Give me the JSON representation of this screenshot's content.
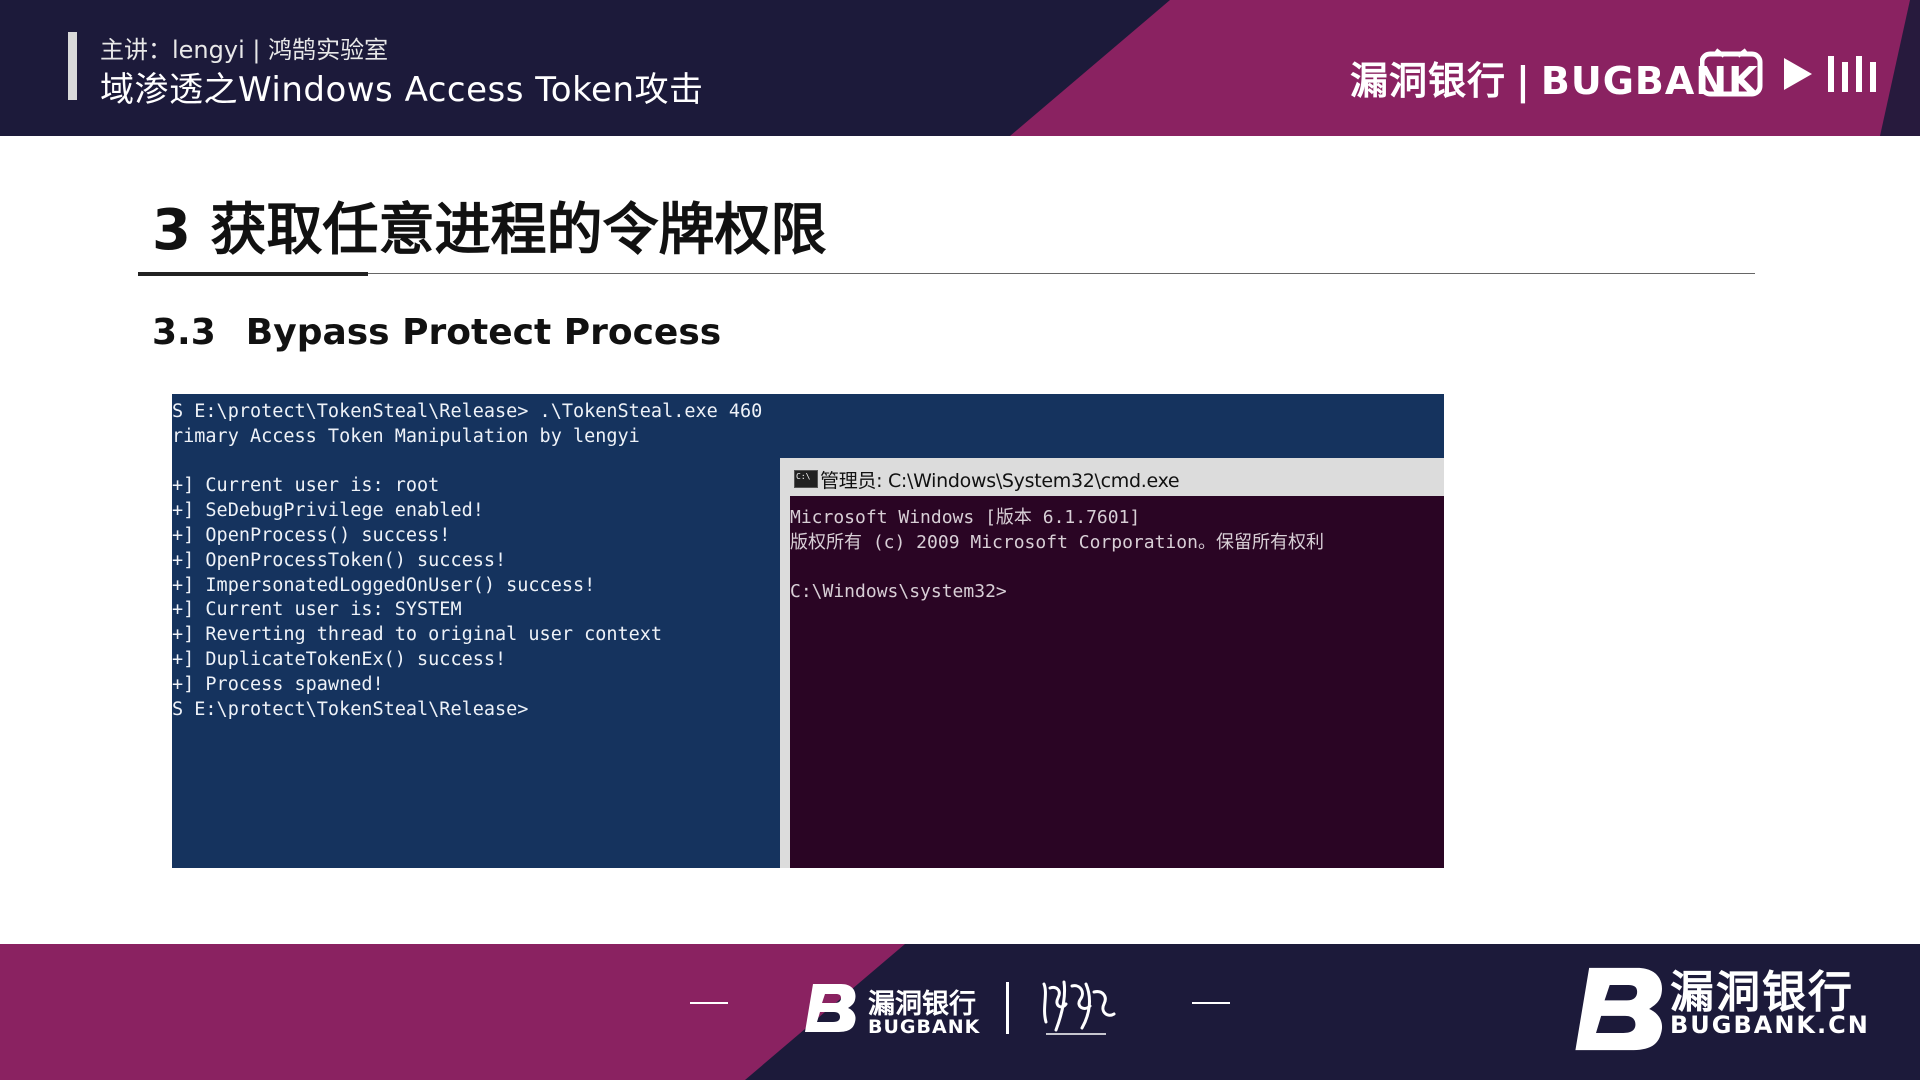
{
  "header": {
    "speaker": "主讲：lengyi | 鸿鹄实验室",
    "course_title": "域渗透之Windows Access Token攻击",
    "brand_cn": "漏洞银行",
    "brand_sep": "|",
    "brand_en": "BUGBANK",
    "watermark_icon": "bilibili-logo-icon"
  },
  "slide": {
    "title": "3 获取任意进程的令牌权限",
    "section_number": "3.3",
    "section_title": "Bypass Protect  Process"
  },
  "powershell": {
    "lines": [
      "S E:\\protect\\TokenSteal\\Release> .\\TokenSteal.exe 460",
      "rimary Access Token Manipulation by lengyi",
      "",
      "+] Current user is: root",
      "+] SeDebugPrivilege enabled!",
      "+] OpenProcess() success!",
      "+] OpenProcessToken() success!",
      "+] ImpersonatedLoggedOnUser() success!",
      "+] Current user is: SYSTEM",
      "+] Reverting thread to original user context",
      "+] DuplicateTokenEx() success!",
      "+] Process spawned!",
      "S E:\\protect\\TokenSteal\\Release>"
    ]
  },
  "cmd_window": {
    "title": "管理员: C:\\Windows\\System32\\cmd.exe",
    "lines": [
      "Microsoft Windows [版本 6.1.7601]",
      "版权所有 (c) 2009 Microsoft Corporation。保留所有权利",
      "",
      "C:\\Windows\\system32>"
    ]
  },
  "footer": {
    "brand_cn": "漏洞银行",
    "brand_en": "BUGBANK",
    "big_brand_cn": "漏洞银行",
    "big_brand_en": "BUGBANK.CN"
  },
  "colors": {
    "header_bg": "#1c1a3a",
    "accent_magenta": "#8a2261",
    "powershell_bg": "#15335e",
    "cmd_bg": "#2a0524"
  }
}
